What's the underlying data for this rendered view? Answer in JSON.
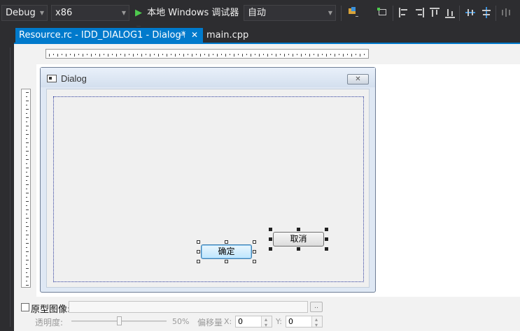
{
  "toolbar": {
    "config": "Debug",
    "platform": "x86",
    "run_label": "本地 Windows 调试器",
    "run_mode": "自动"
  },
  "tabs": [
    {
      "label": "Resource.rc - IDD_DIALOG1 - Dialog*",
      "active": true
    },
    {
      "label": "main.cpp",
      "active": false
    }
  ],
  "tab_pin_icon": "pin-icon",
  "tab_close_icon": "close-icon",
  "colors": {
    "accent": "#007acc",
    "ide_bg": "#2d2d30"
  },
  "dialog": {
    "title": "Dialog",
    "ok_label": "确定",
    "cancel_label": "取消"
  },
  "bottom_panel": {
    "prototype_label": "原型图像:",
    "prototype_path": "",
    "browse_label": "..",
    "transparency_label": "透明度:",
    "transparency_value": "50%",
    "transparency_fraction": 0.5,
    "offset_label": "偏移量",
    "x_label": "X:",
    "x_value": "0",
    "y_label": "Y:",
    "y_value": "0"
  }
}
